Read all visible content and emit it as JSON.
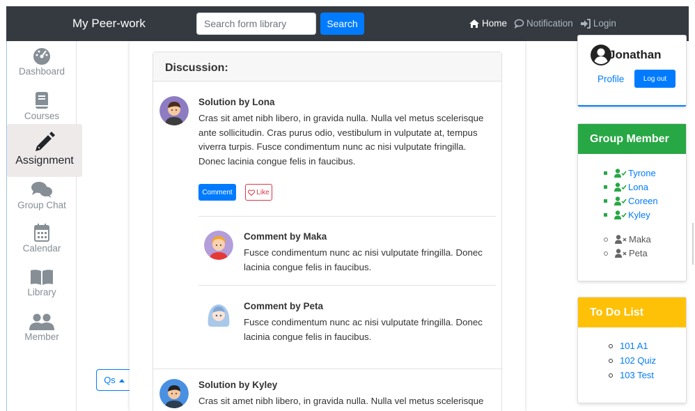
{
  "navbar": {
    "brand": "My Peer-work",
    "search_placeholder": "Search form library",
    "search_button": "Search",
    "links": [
      {
        "label": "Home",
        "icon": "home-icon",
        "active": true
      },
      {
        "label": "Notification",
        "icon": "comment-icon",
        "active": false
      },
      {
        "label": "Login",
        "icon": "sign-in-icon",
        "active": false
      }
    ]
  },
  "sidebar": {
    "items": [
      {
        "label": "Dashboard",
        "icon": "dashboard-gauge-icon"
      },
      {
        "label": "Courses",
        "icon": "book-icon"
      },
      {
        "label": "Assignment",
        "icon": "pencil-icon",
        "active": true
      },
      {
        "label": "Group Chat",
        "icon": "chat-bubbles-icon"
      },
      {
        "label": "Calendar",
        "icon": "calendar-icon"
      },
      {
        "label": "Library",
        "icon": "open-book-icon"
      },
      {
        "label": "Member",
        "icon": "users-icon"
      }
    ]
  },
  "qs_button": "Qs",
  "discussion": {
    "header": "Discussion:",
    "posts": [
      {
        "title": "Solution by Lona",
        "body": "Cras sit amet nibh libero, in gravida nulla. Nulla vel metus scelerisque ante sollicitudin. Cras purus odio, vestibulum in vulputate at, tempus viverra turpis. Fusce condimentum nunc ac nisi vulputate fringilla. Donec lacinia congue felis in faucibus.",
        "comment_button": "Comment",
        "like_button": "Like",
        "comments": [
          {
            "title": "Comment by Maka",
            "body": "Fusce condimentum nunc ac nisi vulputate fringilla. Donec lacinia congue felis in faucibus."
          },
          {
            "title": "Comment by Peta",
            "body": "Fusce condimentum nunc ac nisi vulputate fringilla. Donec lacinia congue felis in faucibus."
          }
        ]
      },
      {
        "title": "Solution by Kyley",
        "body": "Cras sit amet nibh libero, in gravida nulla. Nulla vel metus scelerisque"
      }
    ]
  },
  "profile": {
    "name": "Jonathan",
    "profile_link": "Profile",
    "logout_button": "Log out"
  },
  "group_member": {
    "title": "Group Member",
    "online": [
      "Tyrone",
      "Lona",
      "Coreen",
      "Kyley"
    ],
    "offline": [
      "Maka",
      "Peta"
    ]
  },
  "todo": {
    "title": "To Do List",
    "items": [
      "101 A1",
      "102 Quiz",
      "103 Test"
    ]
  },
  "colors": {
    "navbar": "#343a40",
    "primary": "#007bff",
    "success": "#28a745",
    "warning": "#ffc107",
    "danger": "#dc3545"
  }
}
